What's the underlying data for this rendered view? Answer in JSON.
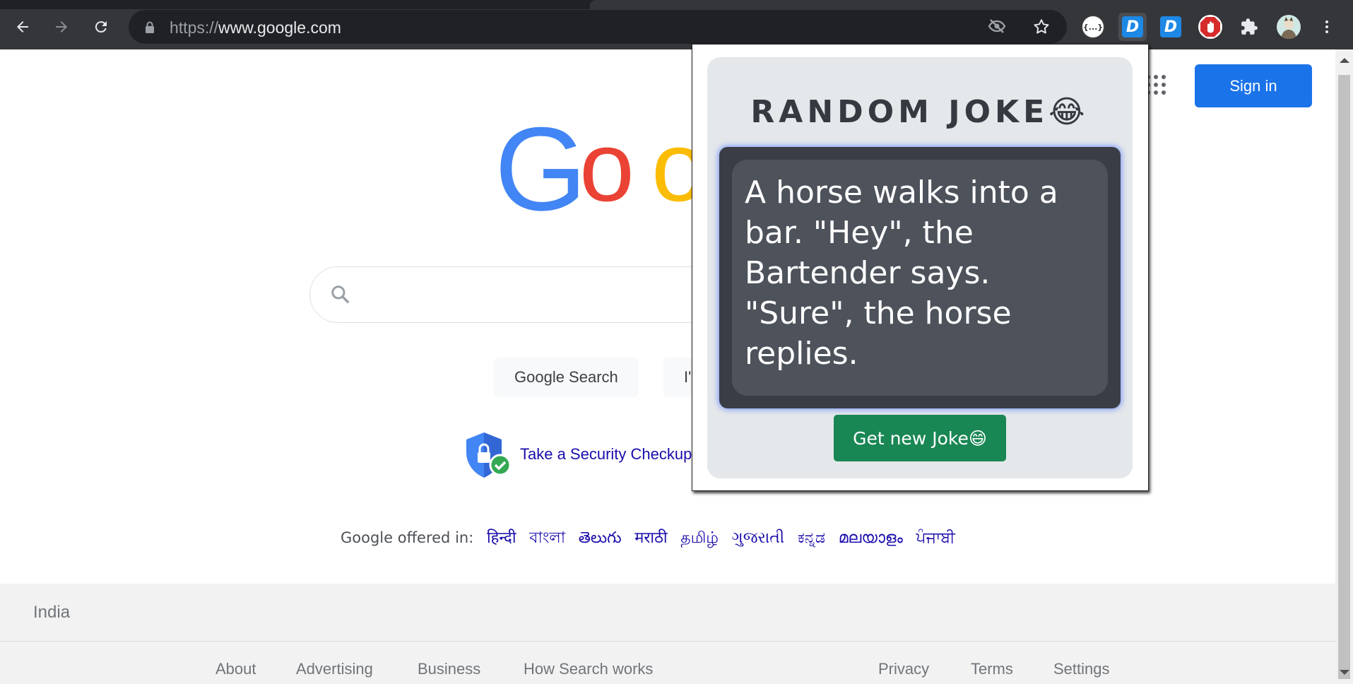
{
  "browser": {
    "url_scheme": "https://",
    "url_host": "www.google.com",
    "extension_icons": [
      "json-viewer-icon",
      "dictionary-icon",
      "dictionary-icon",
      "adblock-icon",
      "puzzle-icon",
      "avatar"
    ]
  },
  "page": {
    "sign_in_label": "Sign in",
    "logo_letters": [
      "G",
      "o",
      "o"
    ],
    "search_button": "Google Search",
    "lucky_button_fragment": "I'",
    "security_link": "Take a Security Checkup",
    "offered_in_label": "Google offered in:",
    "languages": [
      "हिन्दी",
      "বাংলা",
      "తెలుగు",
      "मराठी",
      "தமிழ்",
      "ગુજરાતી",
      "ಕನ್ನಡ",
      "മലയാളം",
      "ਪੰਜਾਬੀ"
    ],
    "footer": {
      "country": "India",
      "left_links": [
        "About",
        "Advertising",
        "Business",
        "How Search works"
      ],
      "right_links": [
        "Privacy",
        "Terms",
        "Settings"
      ]
    }
  },
  "popup": {
    "title": "RANDOM JOKE😂",
    "joke": "A horse walks into a bar. \"Hey\", the Bartender says. \"Sure\", the horse replies.",
    "button_label": "Get new Joke😄"
  },
  "colors": {
    "google_blue": "#4285f4",
    "google_red": "#ea4335",
    "google_yellow": "#fbbc05",
    "joke_button": "#198754",
    "signin_button": "#1a73e8"
  }
}
